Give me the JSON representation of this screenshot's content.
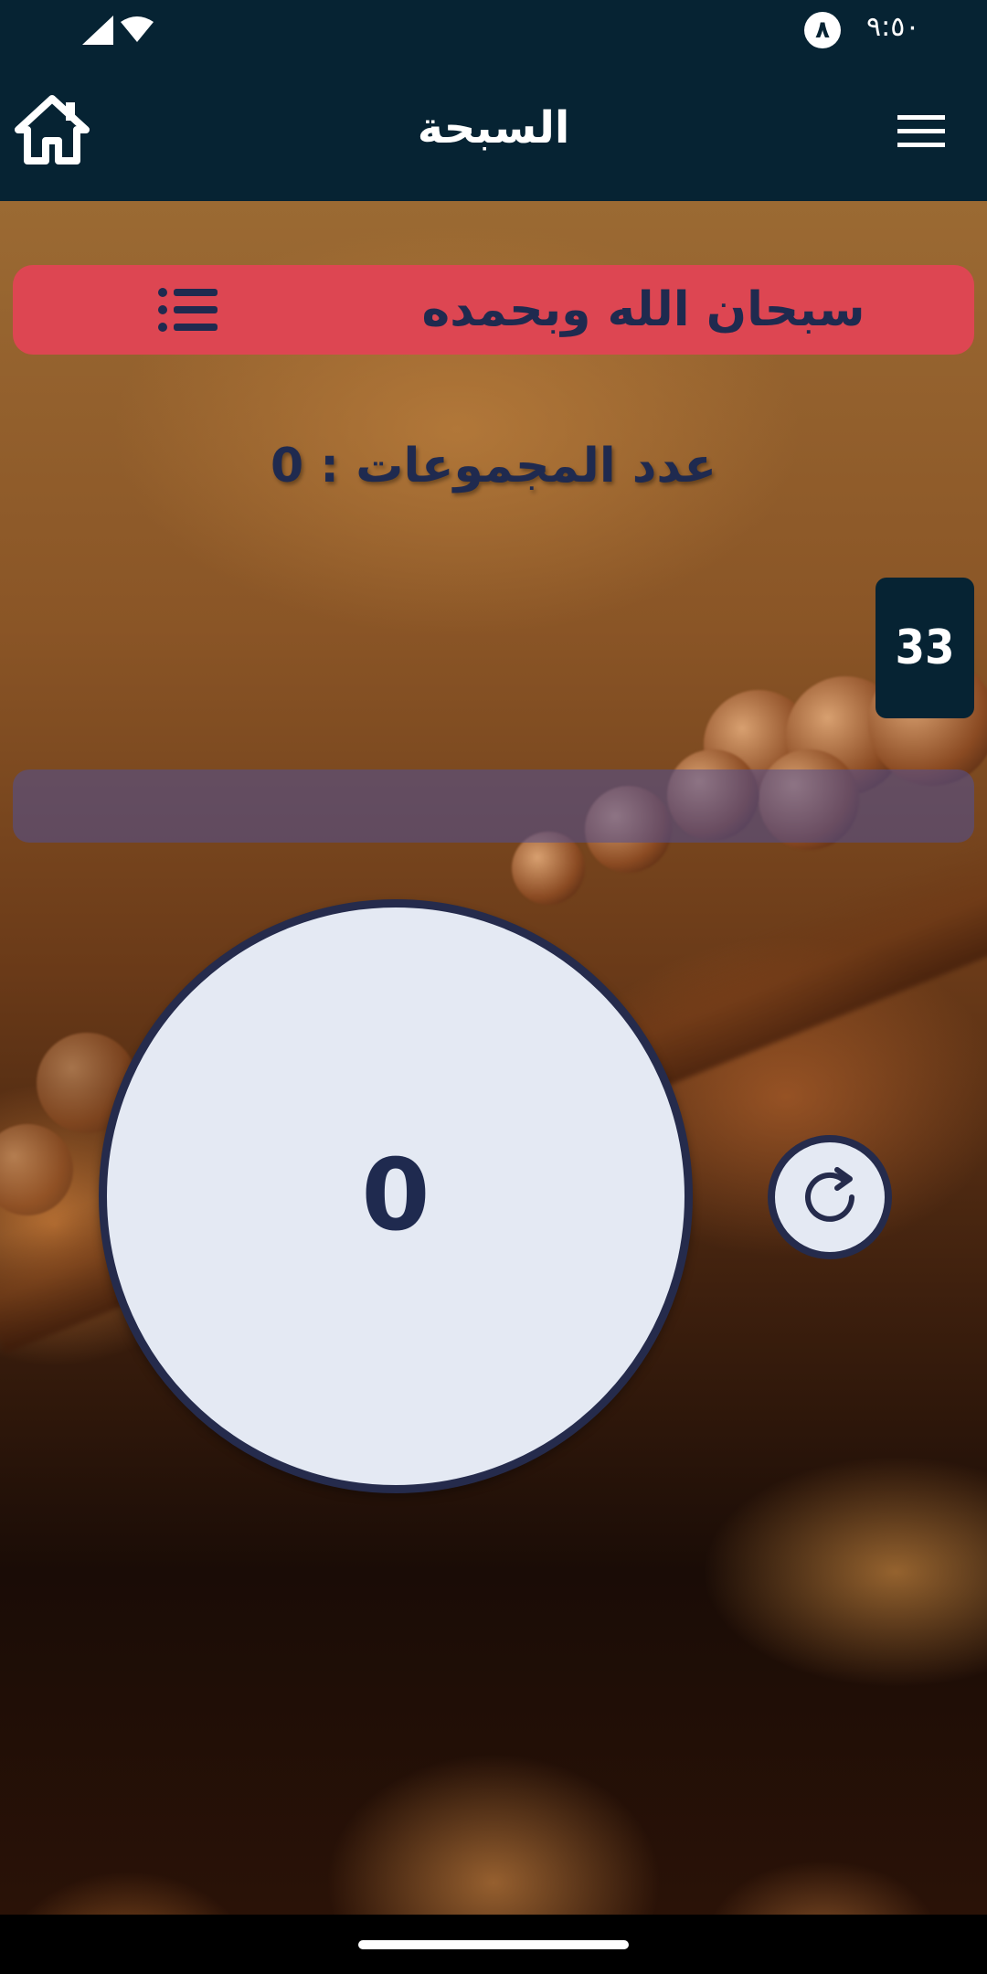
{
  "status_bar": {
    "time": "٩:٥٠",
    "notification_badge": "٨"
  },
  "app_bar": {
    "title": "السبحة",
    "home_icon": "home-icon",
    "menu_icon": "hamburger-menu-icon"
  },
  "dhikr": {
    "current": "سبحان الله وبحمده",
    "list_icon": "list-icon"
  },
  "groups": {
    "label": "عدد المجموعات : 0"
  },
  "target": {
    "value": "33"
  },
  "progress": {
    "fraction": 0
  },
  "counter": {
    "value": "0"
  },
  "reset": {
    "icon": "reset-icon"
  },
  "colors": {
    "bar_background": "#062333",
    "dhikr_bar": "#dd4652",
    "text_dark": "#1f2a4f",
    "circle_fill": "#e4e9f3",
    "circle_border": "#252b4c"
  }
}
